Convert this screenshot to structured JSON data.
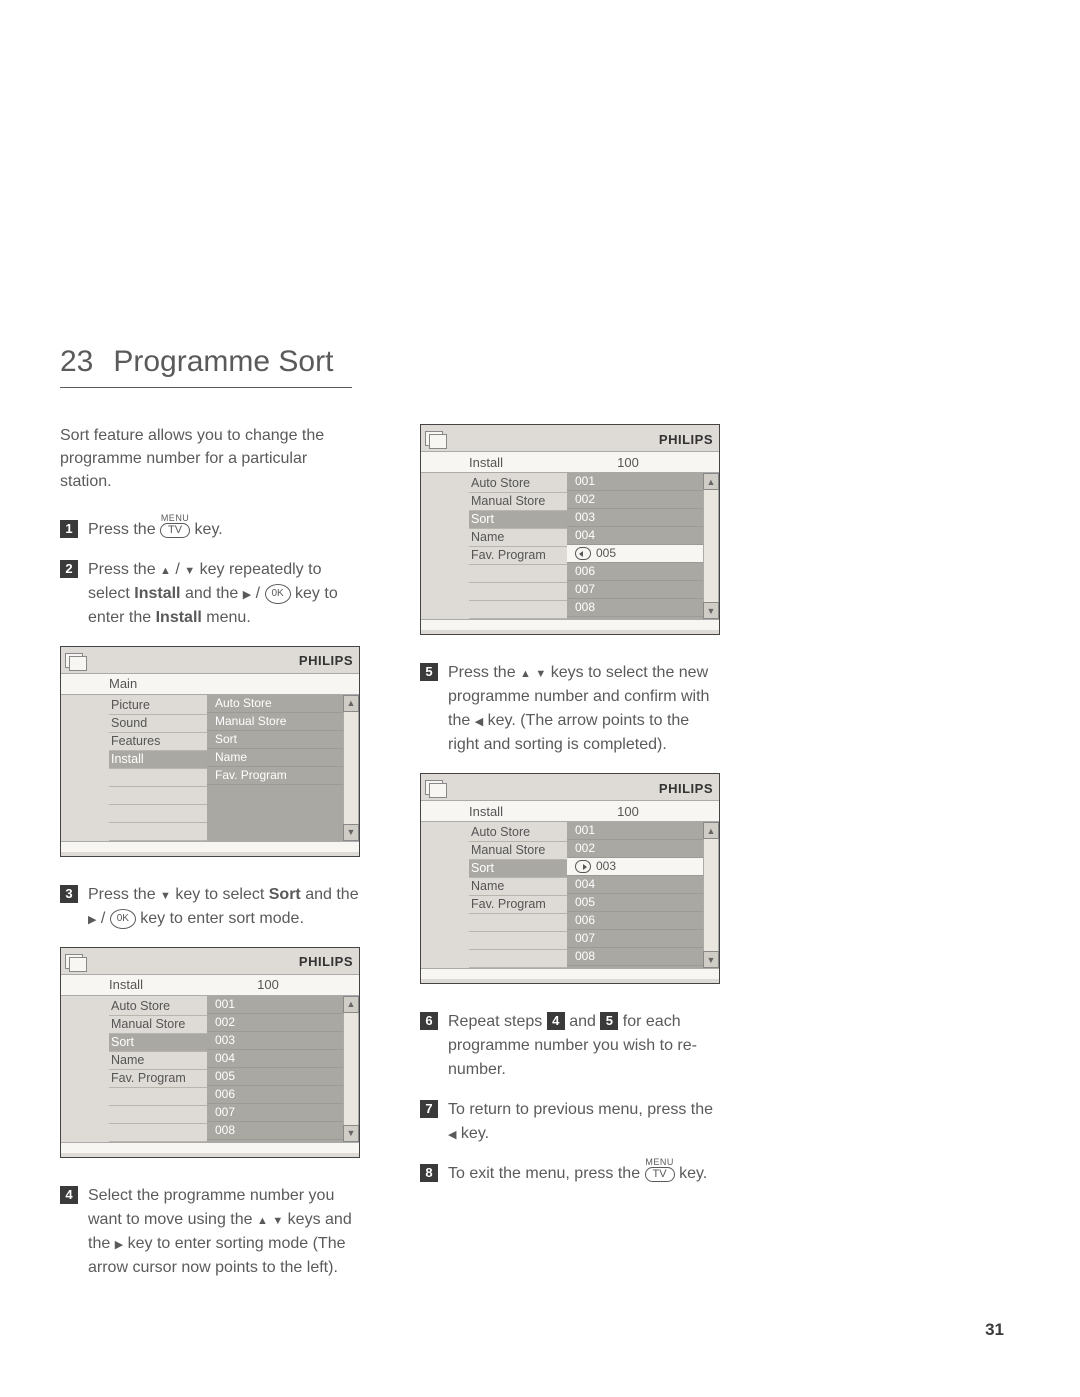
{
  "header": {
    "number": "23",
    "title": "Programme Sort"
  },
  "intro": "Sort feature allows you to change the programme number for a particular station.",
  "keys": {
    "menu_label": "MENU",
    "tv_label": "TV",
    "ok_label": "0K"
  },
  "brand": "PHILIPS",
  "steps": {
    "s1": {
      "num": "1",
      "t1": "Press the ",
      "t2": " key."
    },
    "s2": {
      "num": "2",
      "t1": "Press the ",
      "t2": " key repeatedly to select ",
      "bold": "Install",
      "t3": " and the ",
      "t4": " key to enter the ",
      "bold2": "Install",
      "t5": " menu."
    },
    "s3": {
      "num": "3",
      "t1": "Press the ",
      "t2": " key to select ",
      "bold": "Sort",
      "t3": " and the ",
      "t4": " key to enter sort mode."
    },
    "s4": {
      "num": "4",
      "t1": "Select the programme number you want to move using the ",
      "t2": " keys and the ",
      "t3": " key to enter sorting mode (The arrow cursor now points to the left)."
    },
    "s5": {
      "num": "5",
      "t1": "Press the ",
      "t2": " keys to select the new programme number and confirm with the ",
      "t3": " key. (The arrow points to the right and sorting is completed)."
    },
    "s6": {
      "num": "6",
      "t1": "Repeat steps ",
      "ref1": "4",
      "t2": " and ",
      "ref2": "5",
      "t3": " for each programme number you wish to re-number."
    },
    "s7": {
      "num": "7",
      "t1": "To return to previous menu, press the ",
      "t2": " key."
    },
    "s8": {
      "num": "8",
      "t1": "To exit the menu, press the ",
      "t2": " key."
    }
  },
  "osd1": {
    "title": "Main",
    "menu": [
      "Picture",
      "Sound",
      "Features",
      "Install"
    ],
    "highlight_index": 3,
    "list": [
      "Auto Store",
      "Manual Store",
      "Sort",
      "Name",
      "Fav. Program"
    ]
  },
  "osd2": {
    "title": "Install",
    "right_title": "100",
    "menu": [
      "Auto Store",
      "Manual Store",
      "Sort",
      "Name",
      "Fav. Program"
    ],
    "highlight_index": 2,
    "list": [
      "001",
      "002",
      "003",
      "004",
      "005",
      "006",
      "007",
      "008"
    ]
  },
  "osd3": {
    "title": "Install",
    "right_title": "100",
    "menu": [
      "Auto Store",
      "Manual Store",
      "Sort",
      "Name",
      "Fav. Program"
    ],
    "highlight_index": 2,
    "list": [
      "001",
      "002",
      "003",
      "004",
      "005",
      "006",
      "007",
      "008"
    ],
    "selected_row": 4,
    "cursor": "left",
    "selected_label": "005"
  },
  "osd4": {
    "title": "Install",
    "right_title": "100",
    "menu": [
      "Auto Store",
      "Manual Store",
      "Sort",
      "Name",
      "Fav. Program"
    ],
    "highlight_index": 2,
    "list": [
      "001",
      "002",
      "003",
      "004",
      "005",
      "006",
      "007",
      "008"
    ],
    "selected_row": 2,
    "cursor": "right",
    "selected_label": "003"
  },
  "page_number": "31"
}
